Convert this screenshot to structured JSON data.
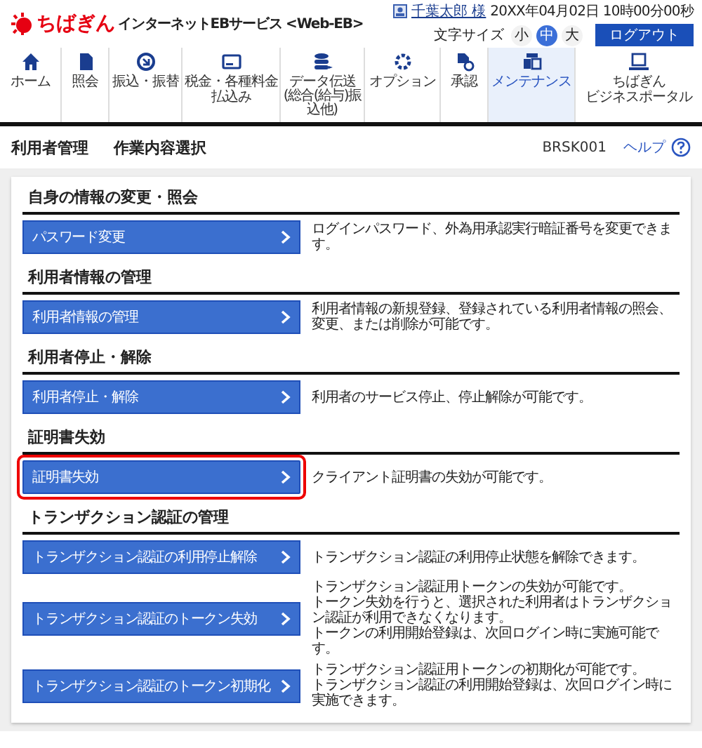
{
  "header": {
    "logo": "ちばぎん",
    "service_name": "インターネットEBサービス <Web-EB>",
    "user": "千葉太郎 様",
    "datetime": "20XX年04月02日 10時00分00秒",
    "text_size_label": "文字サイズ",
    "text_sizes": [
      {
        "label": "小",
        "selected": false
      },
      {
        "label": "中",
        "selected": true
      },
      {
        "label": "大",
        "selected": false
      }
    ],
    "logout_button": "ログアウト"
  },
  "nav": [
    {
      "label_lines": [
        "ホーム"
      ],
      "selected": false
    },
    {
      "label_lines": [
        "照会"
      ],
      "selected": false
    },
    {
      "label_lines": [
        "振込・振替"
      ],
      "selected": false
    },
    {
      "label_lines": [
        "税金・各種料金",
        "払込み"
      ],
      "selected": false
    },
    {
      "label_lines": [
        "データ伝送"
      ],
      "sublabel": "(総合(給与)振込他)",
      "selected": false
    },
    {
      "label_lines": [
        "オプション"
      ],
      "selected": false
    },
    {
      "label_lines": [
        "承認"
      ],
      "selected": false
    },
    {
      "label_lines": [
        "メンテナンス"
      ],
      "selected": true
    },
    {
      "label_lines": [
        "ちばぎん",
        "ビジネスポータル"
      ],
      "selected": false
    }
  ],
  "page_header": {
    "breadcrumb": [
      "利用者管理",
      "作業内容選択"
    ],
    "screen_id": "BRSK001",
    "help": "ヘルプ"
  },
  "sections": [
    {
      "title": "自身の情報の変更・照会",
      "items": [
        {
          "button": "パスワード変更",
          "highlighted": false,
          "description": [
            "ログインパスワード、外為用承認実行暗証番号を変更できます。"
          ]
        }
      ]
    },
    {
      "title": "利用者情報の管理",
      "items": [
        {
          "button": "利用者情報の管理",
          "highlighted": false,
          "description": [
            "利用者情報の新規登録、登録されている利用者情報の照会、変更、または削除が可能です。"
          ]
        }
      ]
    },
    {
      "title": "利用者停止・解除",
      "items": [
        {
          "button": "利用者停止・解除",
          "highlighted": false,
          "description": [
            "利用者のサービス停止、停止解除が可能です。"
          ]
        }
      ]
    },
    {
      "title": "証明書失効",
      "items": [
        {
          "button": "証明書失効",
          "highlighted": true,
          "description": [
            "クライアント証明書の失効が可能です。"
          ]
        }
      ]
    },
    {
      "title": "トランザクション認証の管理",
      "items": [
        {
          "button": "トランザクション認証の利用停止解除",
          "highlighted": false,
          "description": [
            "トランザクション認証の利用停止状態を解除できます。"
          ]
        },
        {
          "button": "トランザクション認証のトークン失効",
          "highlighted": false,
          "description": [
            "トランザクション認証用トークンの失効が可能です。",
            "トークン失効を行うと、選択された利用者はトランザクション認証が利用できなくなります。",
            "トークンの利用開始登録は、次回ログイン時に実施可能です。"
          ]
        },
        {
          "button": "トランザクション認証のトークン初期化",
          "highlighted": false,
          "description": [
            "トランザクション認証用トークンの初期化が可能です。",
            "トランザクション認証の利用開始登録は、次回ログイン時に実施できます。"
          ]
        }
      ]
    }
  ]
}
